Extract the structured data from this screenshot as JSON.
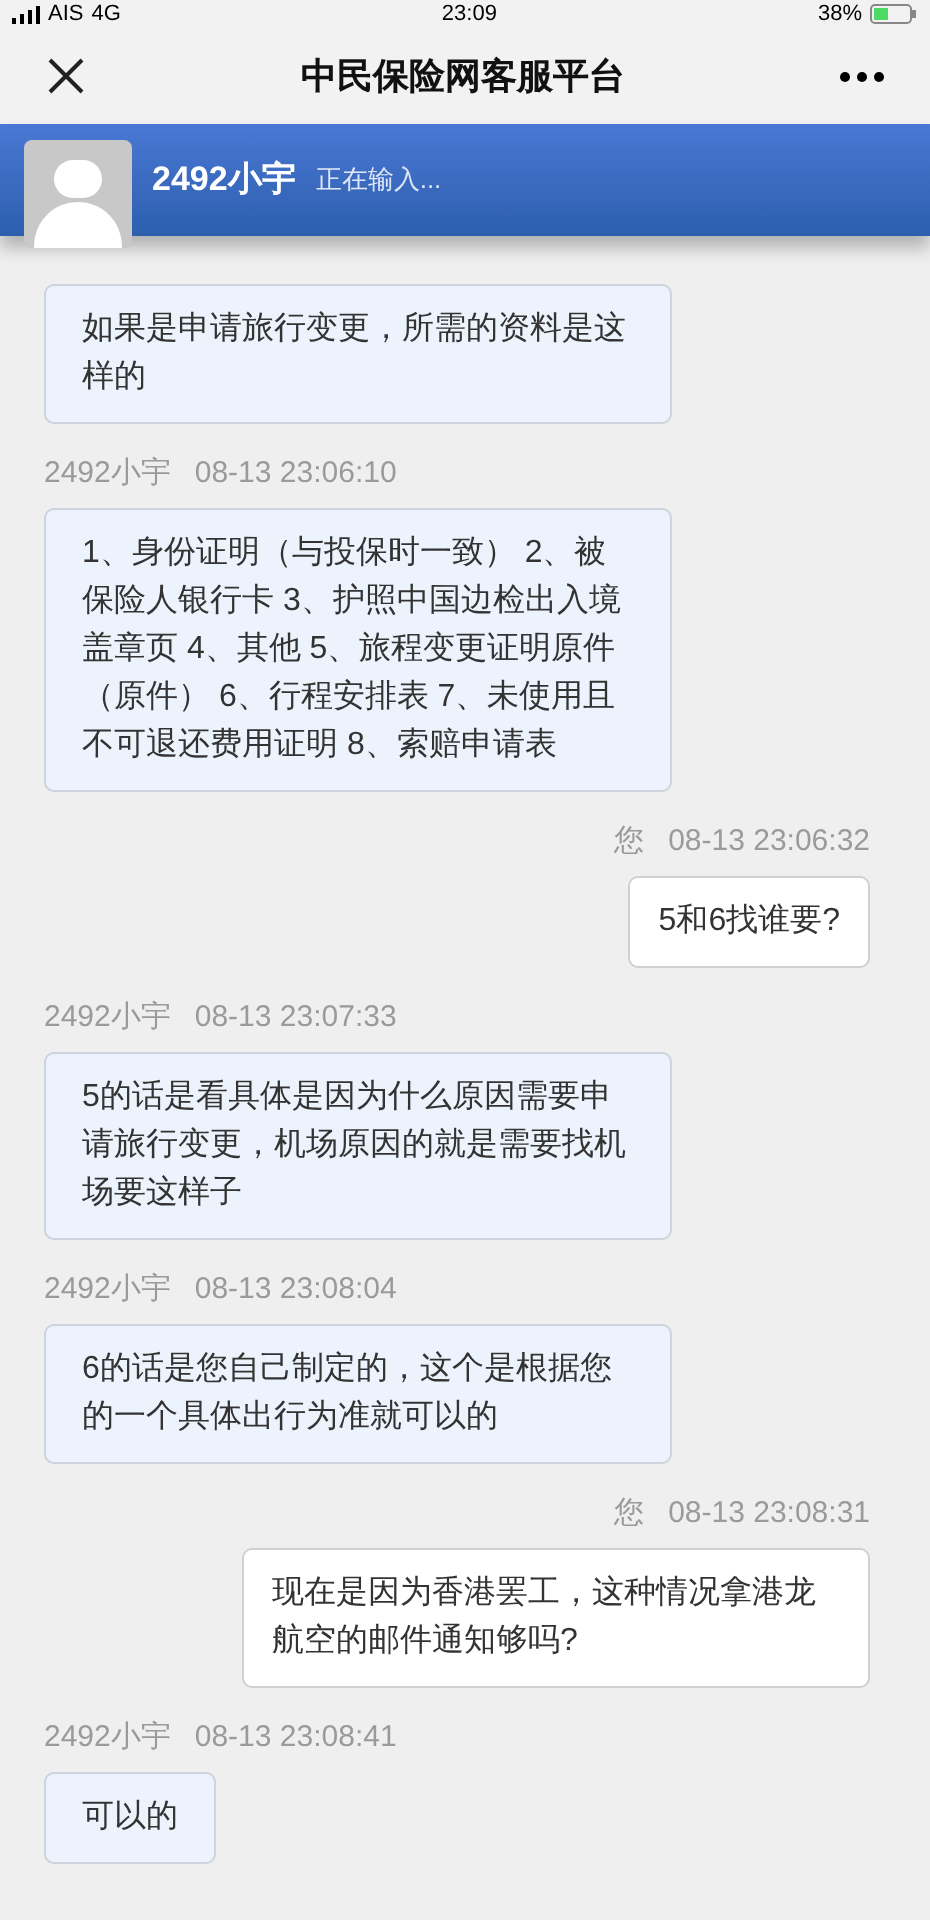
{
  "status_bar": {
    "carrier": "AIS",
    "network": "4G",
    "time": "23:09",
    "battery": "38%"
  },
  "nav": {
    "title": "中民保险网客服平台"
  },
  "agent_bar": {
    "name": "2492小宇",
    "status": "正在输入..."
  },
  "messages": [
    {
      "kind": "agent",
      "text": "如果是申请旅行变更，所需的资料是这样的"
    },
    {
      "kind": "agent",
      "sender": "2492小宇",
      "time": "08-13 23:06:10",
      "text": "1、身份证明（与投保时一致） 2、被保险人银行卡 3、护照中国边检出入境盖章页 4、其他 5、旅程变更证明原件（原件） 6、行程安排表 7、未使用且不可退还费用证明 8、索赔申请表"
    },
    {
      "kind": "user",
      "sender": "您",
      "time": "08-13 23:06:32",
      "text": "5和6找谁要?"
    },
    {
      "kind": "agent",
      "sender": "2492小宇",
      "time": "08-13 23:07:33",
      "text": "5的话是看具体是因为什么原因需要申请旅行变更，机场原因的就是需要找机场要这样子"
    },
    {
      "kind": "agent",
      "sender": "2492小宇",
      "time": "08-13 23:08:04",
      "text": "6的话是您自己制定的，这个是根据您的一个具体出行为准就可以的"
    },
    {
      "kind": "user",
      "sender": "您",
      "time": "08-13 23:08:31",
      "text": "现在是因为香港罢工，这种情况拿港龙航空的邮件通知够吗?"
    },
    {
      "kind": "agent",
      "sender": "2492小宇",
      "time": "08-13 23:08:41",
      "text": "可以的"
    }
  ]
}
